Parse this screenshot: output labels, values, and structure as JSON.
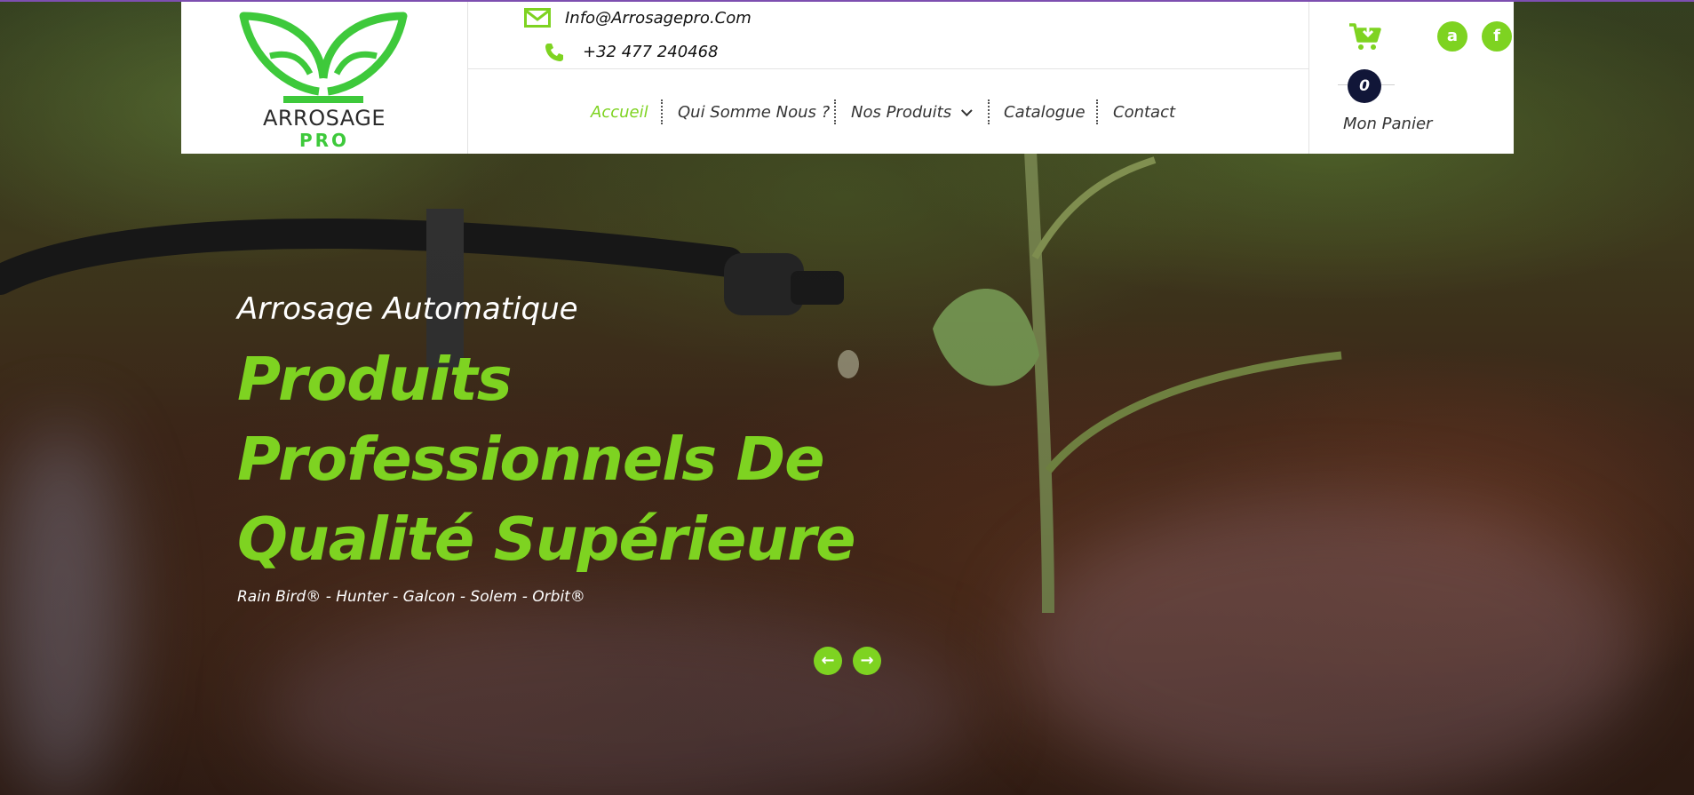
{
  "header": {
    "logo": {
      "line1": "ARROSAGE",
      "line2": "PRO"
    },
    "contact": {
      "email": "Info@Arrosagepro.Com",
      "phone": "+32 477 240468"
    },
    "social": [
      {
        "name": "amazon",
        "glyph": "a"
      },
      {
        "name": "facebook",
        "glyph": "f"
      }
    ],
    "nav": [
      {
        "label": "Accueil",
        "active": true
      },
      {
        "label": "Qui Somme Nous ?",
        "active": false
      },
      {
        "label": "Nos Produits",
        "active": false,
        "has_dropdown": true
      },
      {
        "label": "Catalogue",
        "active": false
      },
      {
        "label": "Contact",
        "active": false
      }
    ],
    "cart": {
      "count": "0",
      "label": "Mon Panier"
    }
  },
  "hero": {
    "eyebrow": "Arrosage Automatique",
    "headline_lines": [
      "Produits",
      "Professionnels De",
      "Qualité Supérieure"
    ],
    "brands": "Rain Bird® - Hunter - Galcon - Solem - Orbit®",
    "prev_glyph": "←",
    "next_glyph": "→"
  },
  "colors": {
    "accent": "#7ed321",
    "logo_green": "#3ec93b",
    "cart_badge": "#111638",
    "top_border": "#7d4fb0"
  }
}
